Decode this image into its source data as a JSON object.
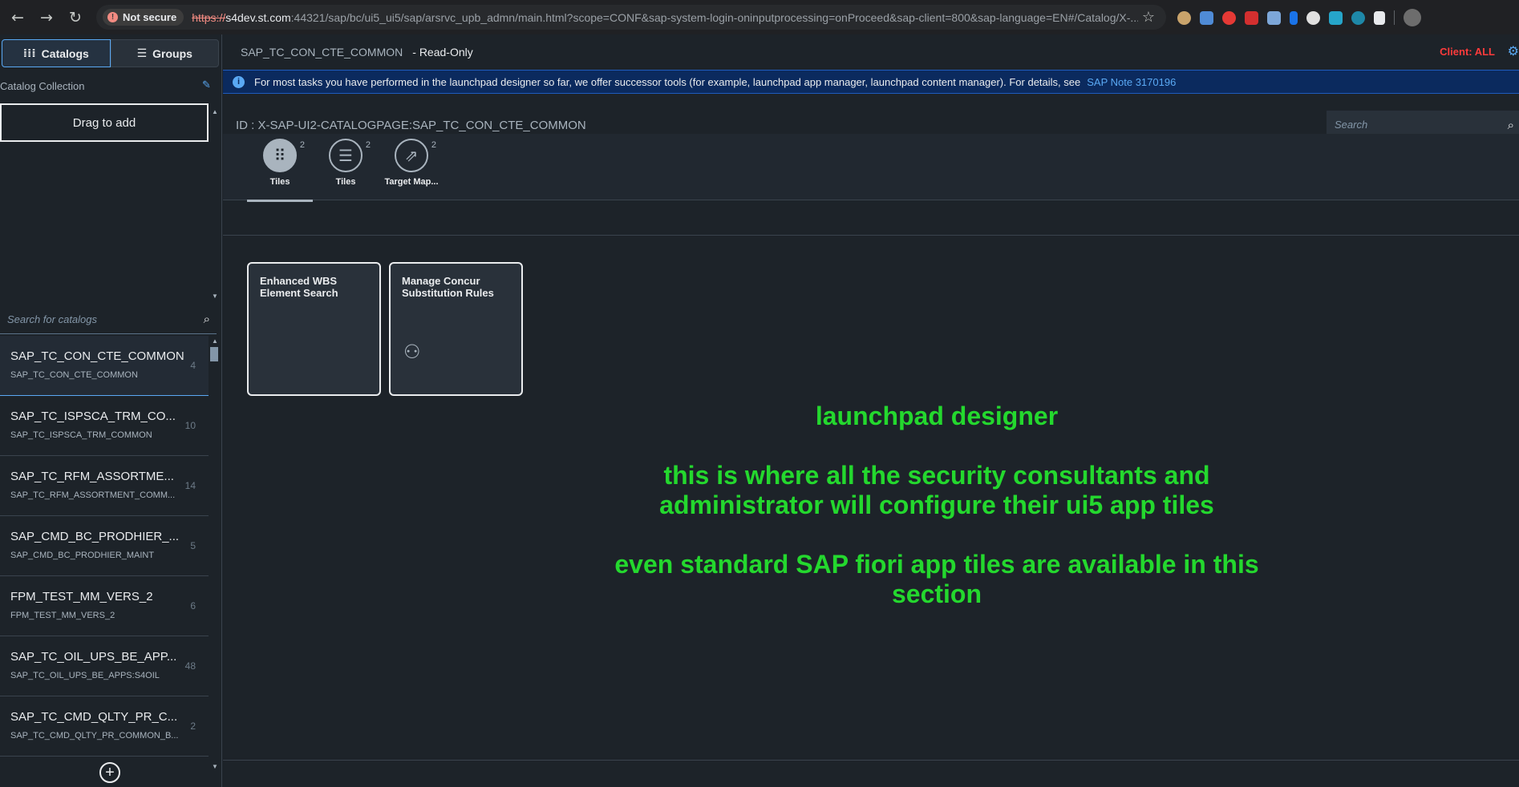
{
  "browser": {
    "back_icon": "←",
    "forward_icon": "→",
    "reload_icon": "↻",
    "not_secure": "Not secure",
    "url_scheme": "https://",
    "url_host": "s4dev.st.com",
    "url_rest": ":44321/sap/bc/ui5_ui5/sap/arsrvc_upb_admn/main.html?scope=CONF&sap-system-login-oninputprocessing=onProceed&sap-client=800&sap-language=EN#/Catalog/X-...",
    "star_icon": "☆"
  },
  "left": {
    "segment_catalogs": "Catalogs",
    "segment_groups": "Groups",
    "collection_label": "Catalog Collection",
    "drag_to_add": "Drag to add",
    "search_placeholder": "Search for catalogs",
    "catalogs": [
      {
        "title": "SAP_TC_CON_CTE_COMMON",
        "subtitle": "SAP_TC_CON_CTE_COMMON",
        "count": "4"
      },
      {
        "title": "SAP_TC_ISPSCA_TRM_CO...",
        "subtitle": "SAP_TC_ISPSCA_TRM_COMMON",
        "count": "10"
      },
      {
        "title": "SAP_TC_RFM_ASSORTME...",
        "subtitle": "SAP_TC_RFM_ASSORTMENT_COMM...",
        "count": "14"
      },
      {
        "title": "SAP_CMD_BC_PRODHIER_...",
        "subtitle": "SAP_CMD_BC_PRODHIER_MAINT",
        "count": "5"
      },
      {
        "title": "FPM_TEST_MM_VERS_2",
        "subtitle": "FPM_TEST_MM_VERS_2",
        "count": "6"
      },
      {
        "title": "SAP_TC_OIL_UPS_BE_APP...",
        "subtitle": "SAP_TC_OIL_UPS_BE_APPS:S4OIL",
        "count": "48"
      },
      {
        "title": "SAP_TC_CMD_QLTY_PR_C...",
        "subtitle": "SAP_TC_CMD_QLTY_PR_COMMON_B...",
        "count": "2"
      }
    ]
  },
  "right": {
    "catalog_name": "SAP_TC_CON_CTE_COMMON",
    "read_only": "- Read-Only",
    "client": "Client: ALL",
    "info_text": "For most tasks you have performed in the launchpad designer so far, we offer successor tools (for example, launchpad app manager, launchpad content manager). For details, see",
    "info_link": "SAP Note 3170196",
    "object_id": "ID : X-SAP-UI2-CATALOGPAGE:SAP_TC_CON_CTE_COMMON",
    "search_placeholder": "Search",
    "tabs": [
      {
        "label": "Tiles",
        "count": "2",
        "icon": "grid-icon"
      },
      {
        "label": "Tiles",
        "count": "2",
        "icon": "list-icon"
      },
      {
        "label": "Target Map...",
        "count": "2",
        "icon": "share-icon"
      }
    ],
    "tiles": [
      {
        "title": "Enhanced WBS Element Search",
        "icon": ""
      },
      {
        "title": "Manage Concur Substitution Rules",
        "icon": "user-settings-icon"
      }
    ]
  },
  "annotation": {
    "line1": "launchpad designer",
    "line2": "this is where all the security consultants and administrator will configure their ui5 app tiles",
    "line3": "even standard SAP fiori app tiles are available in this section",
    "color": "#24d82e"
  }
}
